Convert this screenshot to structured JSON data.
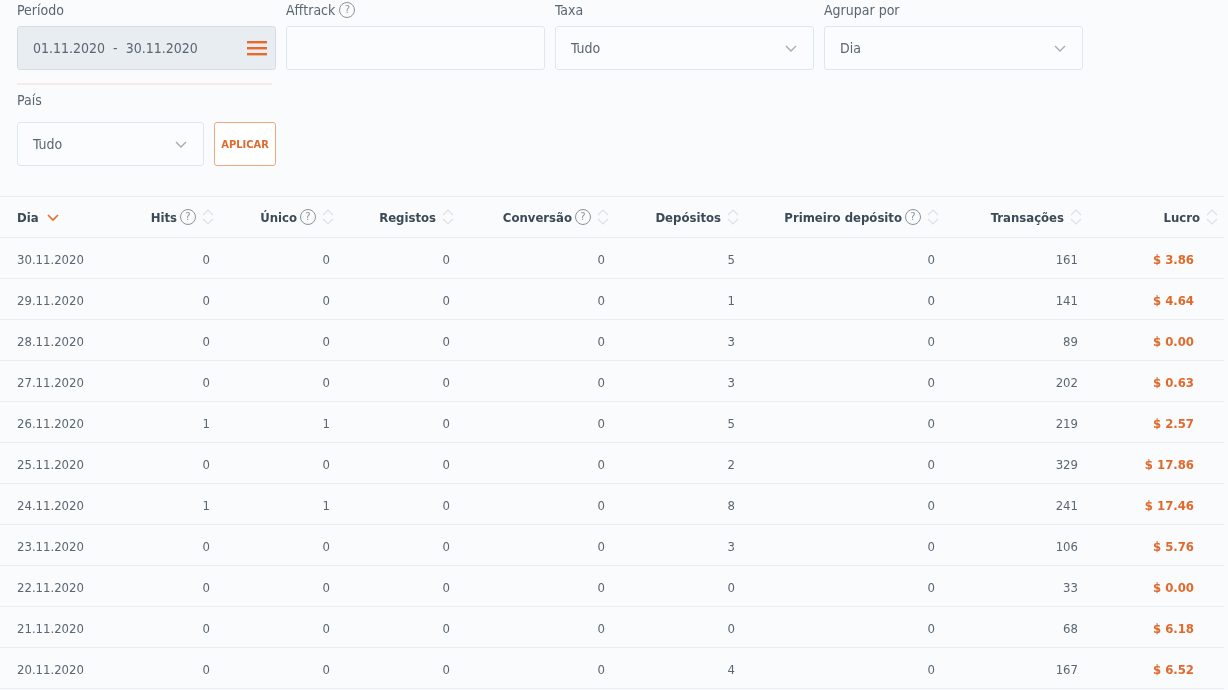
{
  "filters": [
    {
      "kind": "daterange",
      "label": "Período",
      "value": "01.11.2020  -  30.11.2020"
    },
    {
      "kind": "text",
      "label": "Afftrack",
      "help": "?"
    },
    {
      "kind": "select",
      "label": "Taxa",
      "value": "Tudo"
    },
    {
      "kind": "select",
      "label": "Agrupar por",
      "value": "Dia"
    }
  ],
  "country": {
    "label": "País",
    "value": "Tudo"
  },
  "apply_button": "APLICAR",
  "table": {
    "columns": [
      {
        "label": "Dia",
        "sorted": true
      },
      {
        "label": "Hits",
        "help": "?",
        "sorted": false
      },
      {
        "label": "Único",
        "help": "?",
        "sorted": false
      },
      {
        "label": "Registos",
        "sorted": false
      },
      {
        "label": "Conversão",
        "help": "?",
        "sorted": false
      },
      {
        "label": "Depósitos",
        "sorted": false
      },
      {
        "label": "Primeiro depósito",
        "help": "?",
        "sorted": false
      },
      {
        "label": "Transações",
        "sorted": false
      },
      {
        "label": "Lucro",
        "sorted": false
      }
    ],
    "rows": [
      [
        "30.11.2020",
        "0",
        "0",
        "0",
        "0",
        "5",
        "0",
        "161",
        "$ 3.86"
      ],
      [
        "29.11.2020",
        "0",
        "0",
        "0",
        "0",
        "1",
        "0",
        "141",
        "$ 4.64"
      ],
      [
        "28.11.2020",
        "0",
        "0",
        "0",
        "0",
        "3",
        "0",
        "89",
        "$ 0.00"
      ],
      [
        "27.11.2020",
        "0",
        "0",
        "0",
        "0",
        "3",
        "0",
        "202",
        "$ 0.63"
      ],
      [
        "26.11.2020",
        "1",
        "1",
        "0",
        "0",
        "5",
        "0",
        "219",
        "$ 2.57"
      ],
      [
        "25.11.2020",
        "0",
        "0",
        "0",
        "0",
        "2",
        "0",
        "329",
        "$ 17.86"
      ],
      [
        "24.11.2020",
        "1",
        "1",
        "0",
        "0",
        "8",
        "0",
        "241",
        "$ 17.46"
      ],
      [
        "23.11.2020",
        "0",
        "0",
        "0",
        "0",
        "3",
        "0",
        "106",
        "$ 5.76"
      ],
      [
        "22.11.2020",
        "0",
        "0",
        "0",
        "0",
        "0",
        "0",
        "33",
        "$ 0.00"
      ],
      [
        "21.11.2020",
        "0",
        "0",
        "0",
        "0",
        "0",
        "0",
        "68",
        "$ 6.18"
      ],
      [
        "20.11.2020",
        "0",
        "0",
        "0",
        "0",
        "4",
        "0",
        "167",
        "$ 6.52"
      ]
    ]
  }
}
